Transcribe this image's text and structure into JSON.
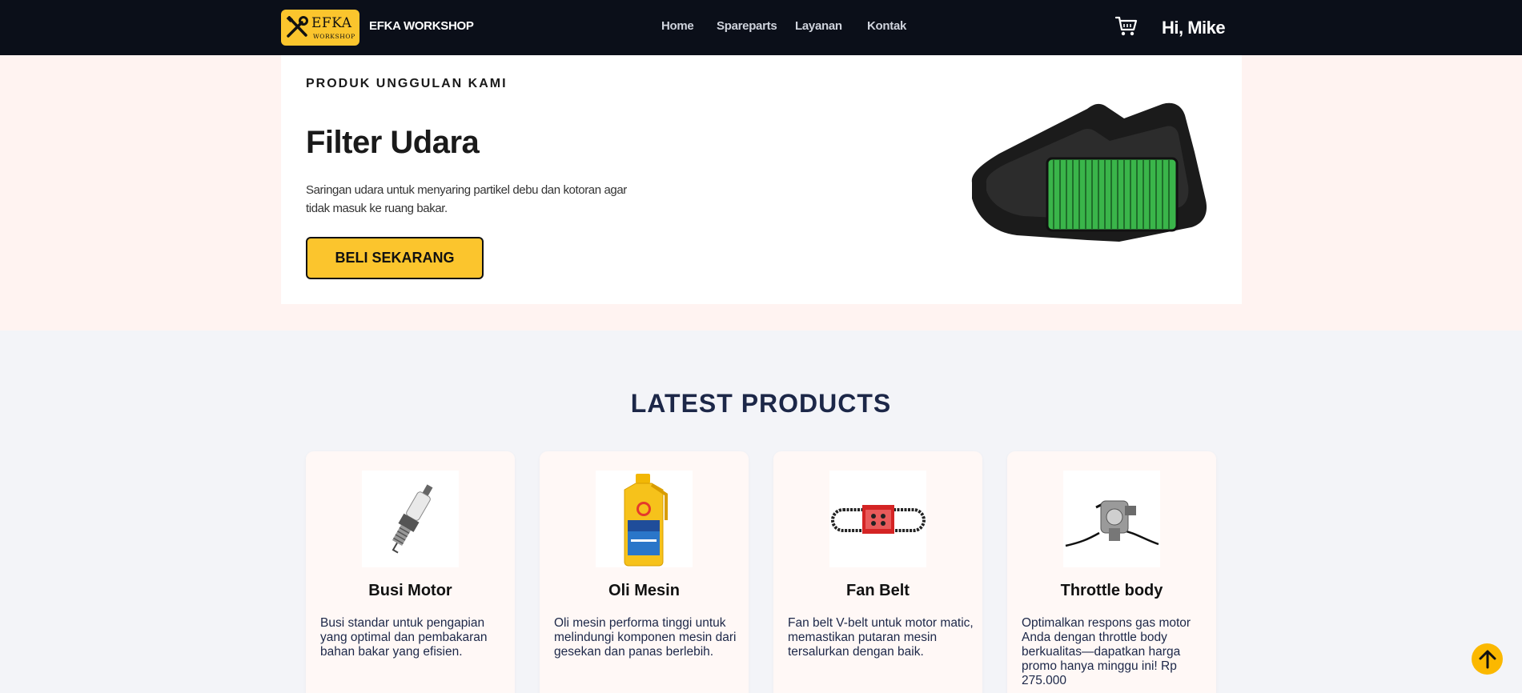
{
  "nav": {
    "logo_main": "EFKA",
    "logo_sub": "WORKSHOP",
    "brand": "EFKA WORKSHOP",
    "links": [
      "Home",
      "Spareparts",
      "Layanan",
      "Kontak"
    ],
    "greeting": "Hi, Mike"
  },
  "hero": {
    "eyebrow": "PRODUK UNGGULAN KAMI",
    "title": "Filter Udara",
    "description": "Saringan udara untuk menyaring partikel debu dan kotoran agar tidak masuk ke ruang bakar.",
    "button": "BELI SEKARANG"
  },
  "latest": {
    "title": "LATEST PRODUCTS",
    "products": [
      {
        "name": "Busi Motor",
        "description": "Busi standar untuk pengapian yang optimal dan pembakaran bahan bakar yang efisien."
      },
      {
        "name": "Oli Mesin",
        "description": "Oli mesin performa tinggi untuk melindungi komponen mesin dari gesekan dan panas berlebih."
      },
      {
        "name": "Fan Belt",
        "description": "Fan belt V-belt untuk motor matic, memastikan putaran mesin tersalurkan dengan baik."
      },
      {
        "name": "Throttle body",
        "description": "Optimalkan respons gas motor Anda dengan throttle body berkualitas—dapatkan harga promo hanya minggu ini! Rp 275.000"
      }
    ]
  },
  "colors": {
    "accent": "#fbc52d",
    "nav_bg": "#0b0f19",
    "heading": "#1c2748"
  },
  "icons": {
    "logo": "tools-icon",
    "cart": "cart-icon",
    "scroll": "arrow-up-icon"
  }
}
